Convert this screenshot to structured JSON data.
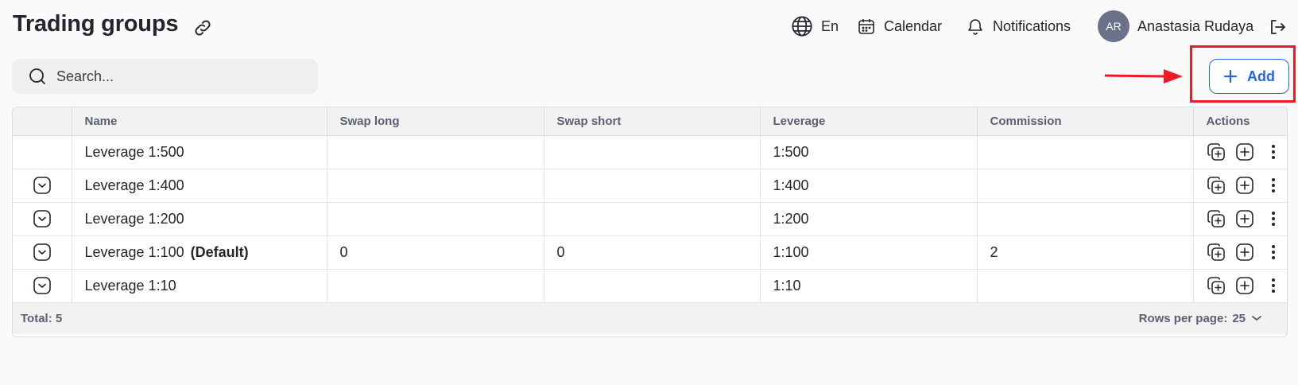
{
  "header": {
    "title": "Trading groups",
    "language": "En",
    "calendar_label": "Calendar",
    "notifications_label": "Notifications",
    "user": {
      "initials": "AR",
      "name": "Anastasia Rudaya"
    }
  },
  "search": {
    "placeholder": "Search..."
  },
  "toolbar": {
    "add_label": "Add"
  },
  "annotation": {
    "color": "#ec1c24"
  },
  "table": {
    "columns": [
      "Name",
      "Swap long",
      "Swap short",
      "Leverage",
      "Commission",
      "Actions"
    ],
    "rows": [
      {
        "expandable": false,
        "name": "Leverage 1:500",
        "default_tag": "",
        "swap_long": "",
        "swap_short": "",
        "leverage": "1:500",
        "commission": ""
      },
      {
        "expandable": true,
        "name": "Leverage 1:400",
        "default_tag": "",
        "swap_long": "",
        "swap_short": "",
        "leverage": "1:400",
        "commission": ""
      },
      {
        "expandable": true,
        "name": "Leverage 1:200",
        "default_tag": "",
        "swap_long": "",
        "swap_short": "",
        "leverage": "1:200",
        "commission": ""
      },
      {
        "expandable": true,
        "name": "Leverage 1:100",
        "default_tag": "(Default)",
        "swap_long": "0",
        "swap_short": "0",
        "leverage": "1:100",
        "commission": "2"
      },
      {
        "expandable": true,
        "name": "Leverage 1:10",
        "default_tag": "",
        "swap_long": "",
        "swap_short": "",
        "leverage": "1:10",
        "commission": ""
      }
    ],
    "footer": {
      "total": "Total: 5",
      "rows_per_page_label": "Rows per page:",
      "rows_per_page_value": "25"
    }
  },
  "colors": {
    "accent": "#2563eb",
    "text": "#23262f",
    "avatar_bg": "#6a7188"
  }
}
